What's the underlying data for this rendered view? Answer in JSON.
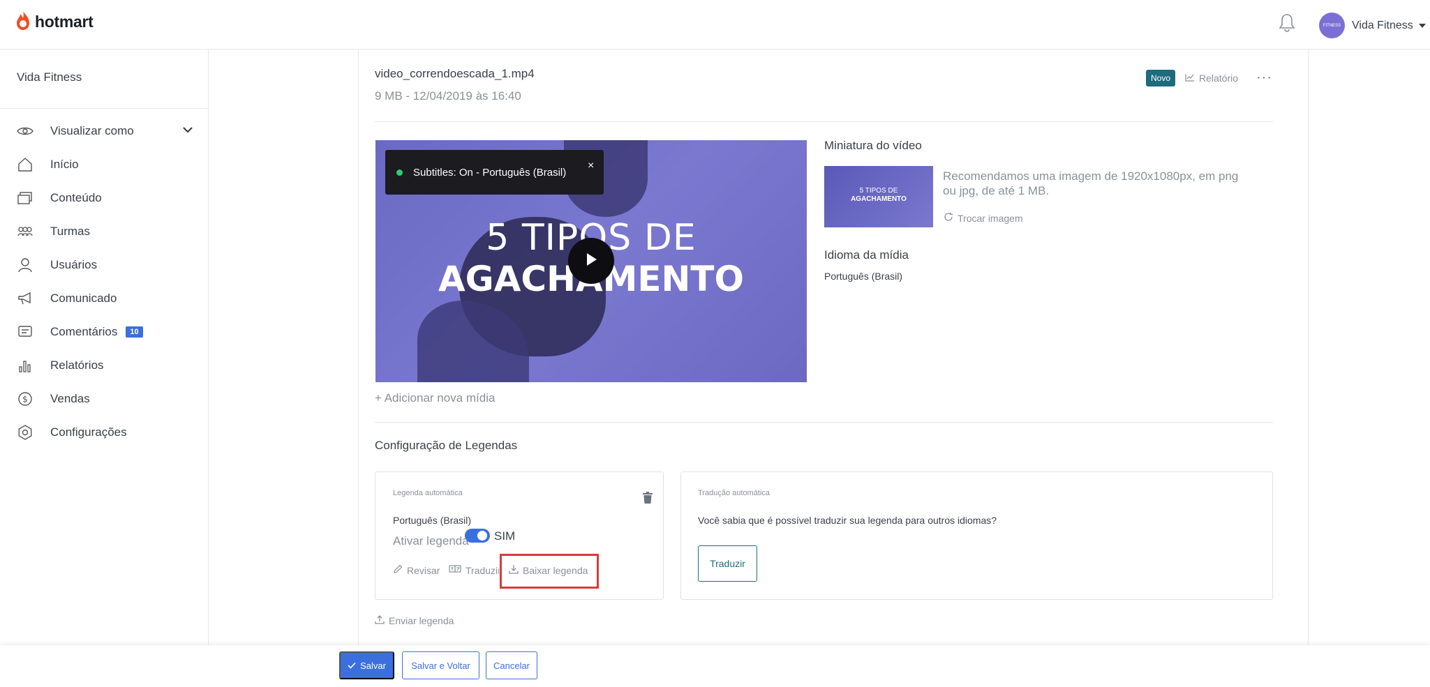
{
  "header": {
    "brand": "hotmart",
    "user_name": "Vida Fitness",
    "avatar_text": "FITNESS"
  },
  "sidebar": {
    "title": "Vida Fitness",
    "items": [
      {
        "label": "Visualizar como",
        "icon": "eye-icon"
      },
      {
        "label": "Início",
        "icon": "home-icon"
      },
      {
        "label": "Conteúdo",
        "icon": "folders-icon"
      },
      {
        "label": "Turmas",
        "icon": "group-icon"
      },
      {
        "label": "Usuários",
        "icon": "user-icon"
      },
      {
        "label": "Comunicado",
        "icon": "megaphone-icon"
      },
      {
        "label": "Comentários",
        "icon": "comment-icon",
        "badge": "10"
      },
      {
        "label": "Relatórios",
        "icon": "bar-chart-icon"
      },
      {
        "label": "Vendas",
        "icon": "dollar-icon"
      },
      {
        "label": "Configurações",
        "icon": "gear-icon"
      }
    ]
  },
  "media": {
    "file_name": "video_correndoescada_1.mp4",
    "file_meta": "9 MB - 12/04/2019 às 16:40",
    "badge": "Novo",
    "report_label": "Relatório",
    "more_label": "···",
    "video_line1": "5 TIPOS DE",
    "video_line2": "AGACHAMENTO",
    "subtitle_tip": "Subtitles: On - Português (Brasil)",
    "subtitle_close": "×",
    "add_media": "+ Adicionar nova mídia"
  },
  "thumbnail": {
    "title": "Miniatura do vídeo",
    "thumb_line1": "5 TIPOS DE",
    "thumb_line2": "AGACHAMENTO",
    "note": "Recomendamos uma imagem de 1920x1080px, em png ou jpg, de até 1 MB.",
    "swap_label": "Trocar imagem",
    "lang_title": "Idioma da mídia",
    "lang_value": "Português (Brasil)"
  },
  "subtitles": {
    "section_title": "Configuração de Legendas",
    "auto_label": "Legenda automática",
    "auto_lang": "Português (Brasil)",
    "activate_label": "Ativar legenda",
    "toggle_value": "SIM",
    "review_label": "Revisar",
    "translate_label": "Traduzir",
    "download_label": "Baixar legenda",
    "trans_box_label": "Tradução automática",
    "trans_text": "Você sabia que é possível traduzir sua legenda para outros idiomas?",
    "trans_button": "Traduzir",
    "send_label": "Enviar legenda"
  },
  "footer": {
    "save": "Salvar",
    "save_back": "Salvar e Voltar",
    "cancel": "Cancelar"
  },
  "colors": {
    "accent": "#3c6fde",
    "teal": "#1f6b7d",
    "brand_orange": "#f04e23",
    "highlight": "#d93a3a",
    "video_purple": "#7a78cf"
  }
}
